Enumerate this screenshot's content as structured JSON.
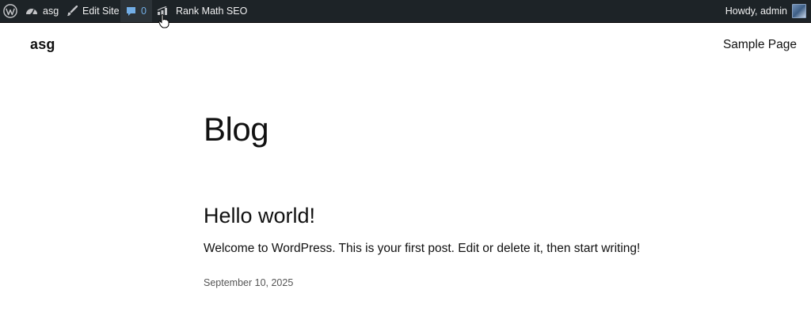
{
  "admin_bar": {
    "site_name": "asg",
    "edit_site": "Edit Site",
    "comments_count": "0",
    "rank_math": "Rank Math SEO",
    "howdy": "Howdy, admin"
  },
  "header": {
    "site_title": "asg",
    "nav": [
      "Sample Page"
    ]
  },
  "main": {
    "heading": "Blog",
    "posts": [
      {
        "title": "Hello world!",
        "excerpt": "Welcome to WordPress. This is your first post. Edit or delete it, then start writing!",
        "date": "September 10, 2025"
      }
    ]
  },
  "colors": {
    "admin_bar_bg": "#1d2327",
    "comments_accent": "#72aee6"
  },
  "icons": [
    "wordpress-logo-icon",
    "dashboard-icon",
    "brush-icon",
    "comment-bubble-icon",
    "rank-math-icon",
    "avatar"
  ]
}
